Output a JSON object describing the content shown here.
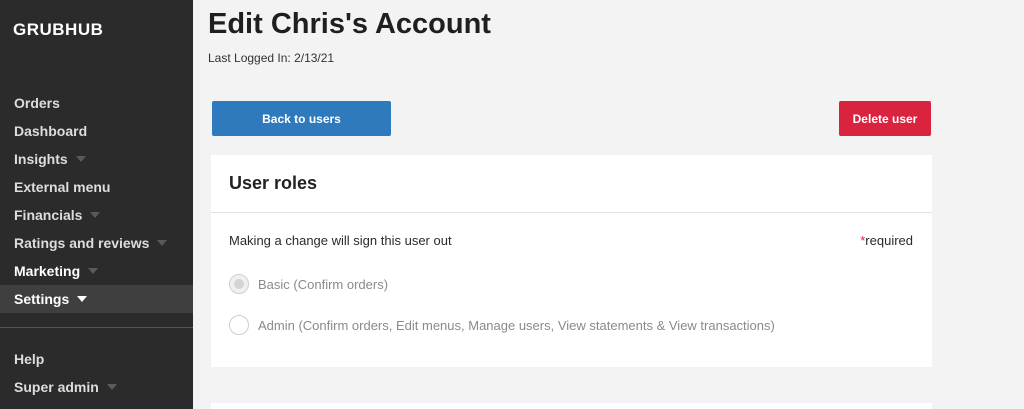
{
  "sidebar": {
    "brand": "GRUBHUB",
    "items": [
      {
        "label": "Orders"
      },
      {
        "label": "Dashboard"
      },
      {
        "label": "Insights"
      },
      {
        "label": "External menu"
      },
      {
        "label": "Financials"
      },
      {
        "label": "Ratings and reviews"
      },
      {
        "label": "Marketing"
      },
      {
        "label": "Settings"
      },
      {
        "label": "Help"
      },
      {
        "label": "Super admin"
      }
    ]
  },
  "header": {
    "title": "Edit Chris's Account",
    "last_logged_in": "Last Logged In: 2/13/21"
  },
  "actions": {
    "back_label": "Back to users",
    "delete_label": "Delete user"
  },
  "user_roles": {
    "title": "User roles",
    "notice": "Making a change will sign this user out",
    "required_mark": "*",
    "required_text": "required",
    "options": [
      {
        "label": "Basic (Confirm orders)",
        "selected": true
      },
      {
        "label": "Admin (Confirm orders, Edit menus, Manage users, View statements & View transactions)",
        "selected": false
      }
    ]
  },
  "colors": {
    "sidebar_bg": "#2b2b2b",
    "primary_blue": "#2f79bd",
    "danger_red": "#d9233f",
    "page_bg": "#f3f3f3"
  }
}
